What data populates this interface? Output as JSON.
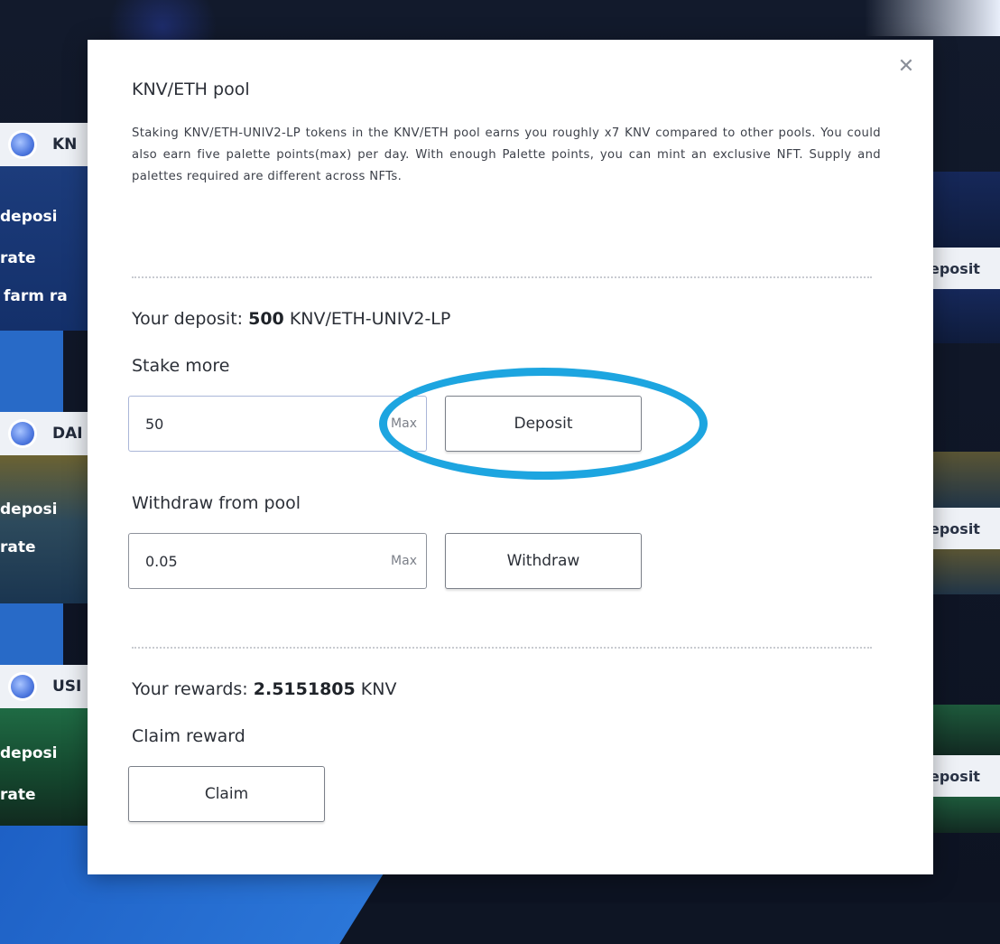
{
  "modal": {
    "close_icon": "✕",
    "title": "KNV/ETH pool",
    "description": "Staking KNV/ETH-UNIV2-LP tokens in the KNV/ETH pool earns you roughly x7 KNV compared to other pools. You could also earn five palette points(max) per day. With enough Palette points, you can mint an exclusive NFT. Supply and palettes required are different across NFTs.",
    "deposit_info": {
      "prefix": "Your deposit: ",
      "amount": "500",
      "unit": " KNV/ETH-UNIV2-LP"
    },
    "stake": {
      "label": "Stake more",
      "input_value": "50",
      "max_label": "Max",
      "button_label": "Deposit"
    },
    "withdraw": {
      "label": "Withdraw from pool",
      "input_value": "0.05",
      "max_label": "Max",
      "button_label": "Withdraw"
    },
    "rewards_info": {
      "prefix": "Your rewards: ",
      "amount": "2.5151805",
      "unit": " KNV"
    },
    "claim": {
      "label": "Claim reward",
      "button_label": "Claim"
    }
  },
  "background": {
    "pools": [
      {
        "name": "KN",
        "rows": [
          "deposi",
          "rate",
          "farm ra"
        ]
      },
      {
        "name": "DAI",
        "rows": [
          "deposi",
          "rate"
        ]
      },
      {
        "name": "USI",
        "rows": [
          "deposi",
          "rate"
        ]
      }
    ],
    "side_button_label": "eposit"
  },
  "colors": {
    "highlight_ring": "#1da5e0",
    "brand_blue": "#2a6fd0"
  }
}
